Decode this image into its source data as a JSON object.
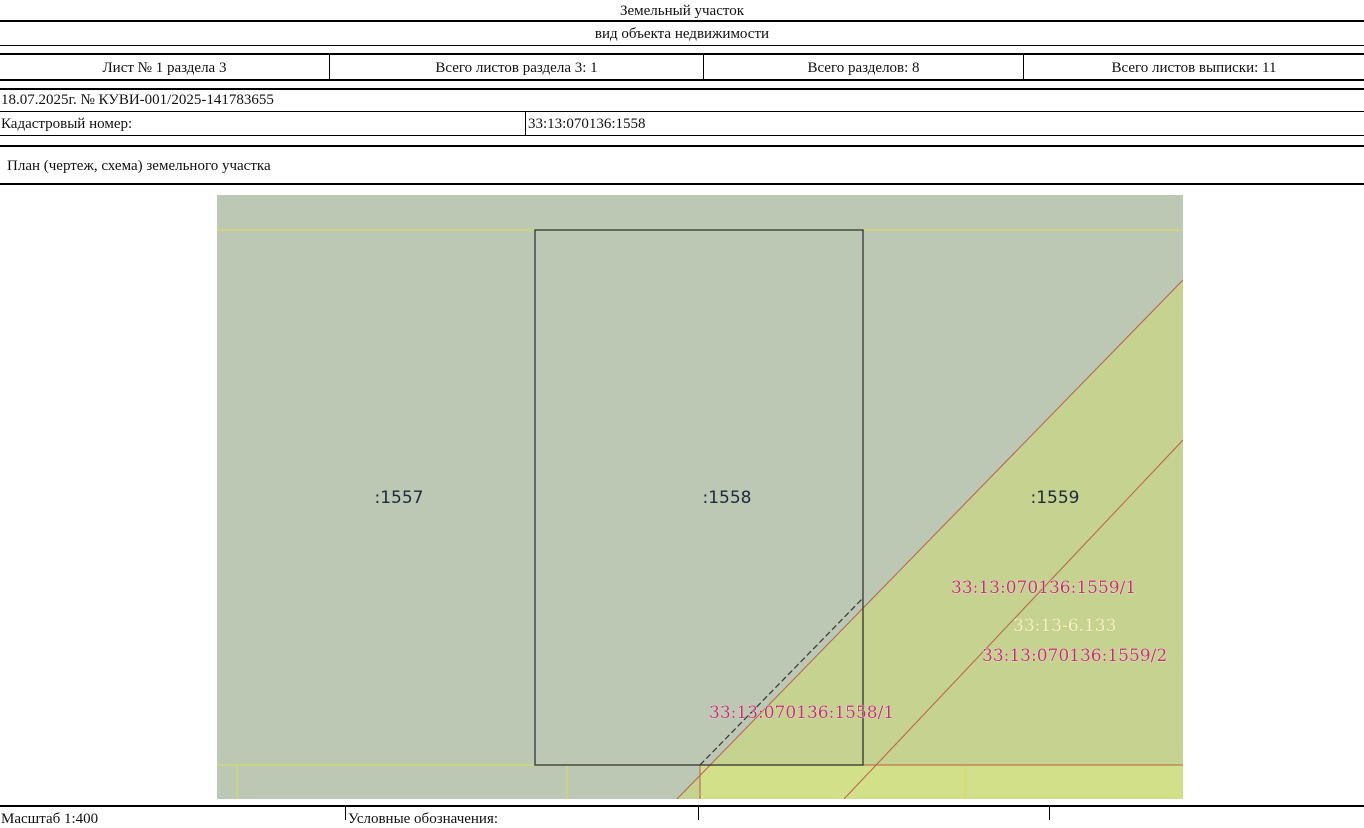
{
  "header": {
    "title": "Земельный участок",
    "subtitle": "вид объекта недвижимости"
  },
  "sheet_info": {
    "sheet": "Лист № 1 раздела 3",
    "section_sheets": "Всего листов раздела 3: 1",
    "total_sections": "Всего разделов: 8",
    "total_sheets": "Всего листов выписки: 11"
  },
  "extract": {
    "date_number": "18.07.2025г. № КУВИ-001/2025-141783655",
    "cadastral_label": "Кадастровый номер:",
    "cadastral_value": "33:13:070136:1558"
  },
  "plan": {
    "heading": "План (чертеж, схема) земельного участка",
    "parcels": [
      ":1557",
      ":1558",
      ":1559"
    ],
    "parts": [
      "33:13:070136:1559/1",
      "33:13:070136:1559/2",
      "33:13:070136:1558/1"
    ],
    "zone": "33:13-6.133",
    "colors": {
      "background": "#bcc8b3",
      "zone_fill": "#c8d38a",
      "road_strip": "#d6e388",
      "outline": "#333333",
      "part_lines": "#b8604a",
      "grid_lines": "#d8d86a"
    }
  },
  "footer": {
    "scale": "Масштаб 1:400",
    "legend": "Условные обозначения:"
  }
}
